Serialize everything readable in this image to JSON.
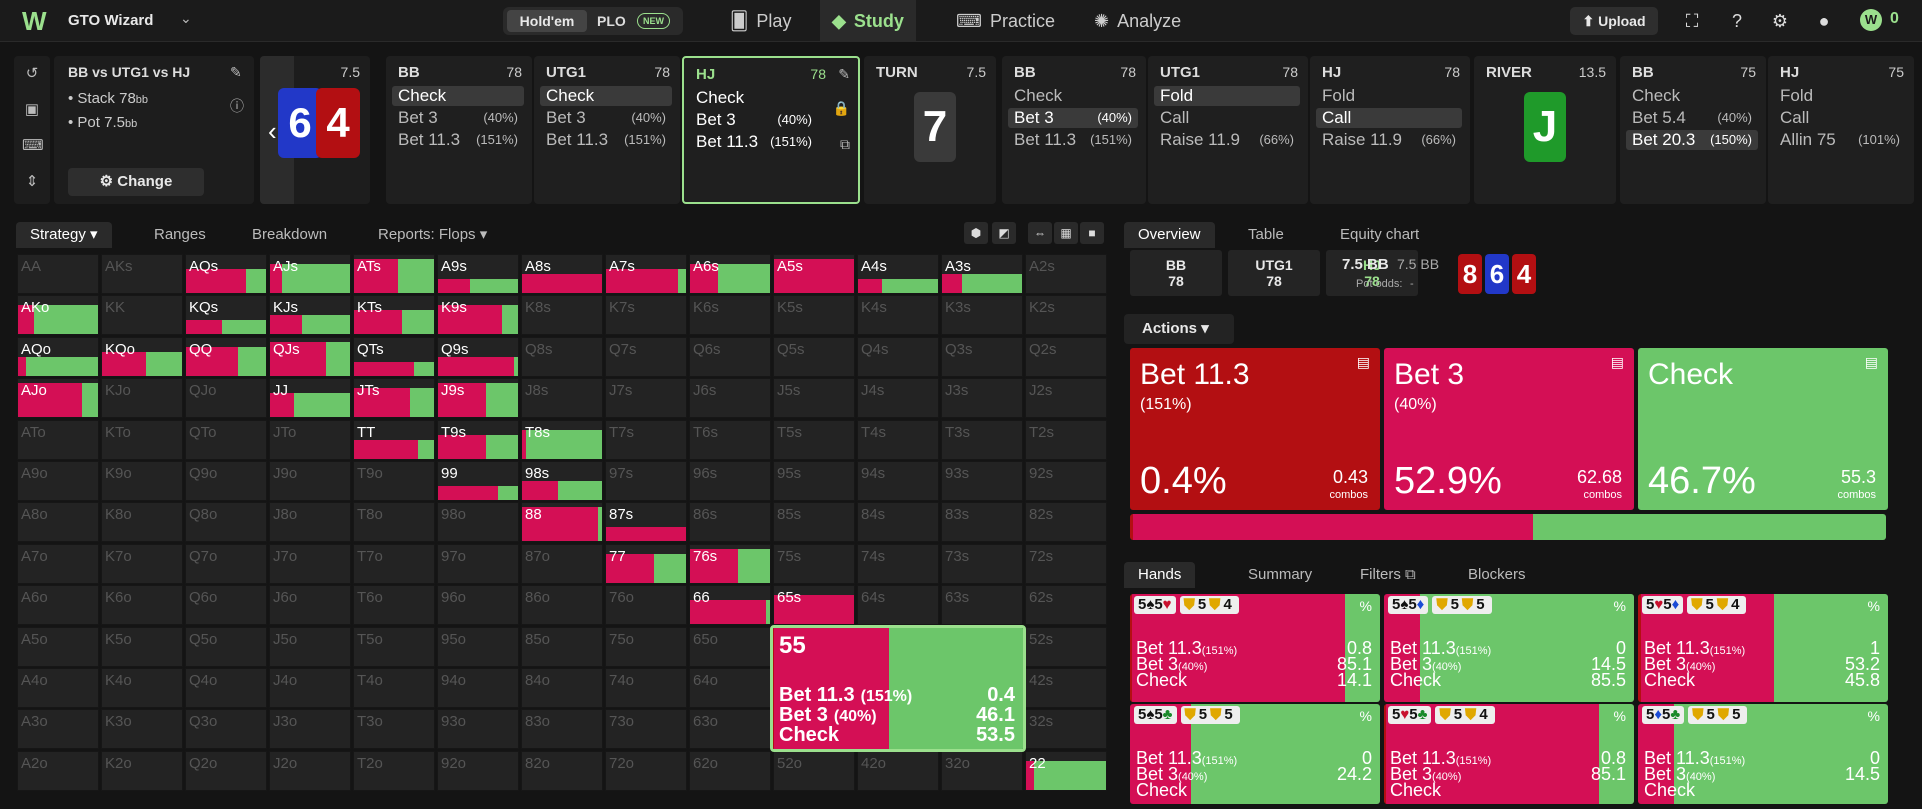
{
  "app": {
    "brand": "GTO Wizard",
    "game_holdem": "Hold'em",
    "game_plo": "PLO",
    "new_badge": "NEW",
    "nav": [
      "Play",
      "Study",
      "Practice",
      "Analyze"
    ],
    "upload": "Upload",
    "coins": "0"
  },
  "info": {
    "title": "BB vs UTG1 vs HJ",
    "stack": "• Stack 78",
    "stack_unit": "bb",
    "pot": "• Pot 7.5",
    "pot_unit": "bb",
    "change": "Change",
    "flop_pot": "7.5"
  },
  "flop_cards": [
    {
      "rank": "6",
      "color": "#2238c8"
    },
    {
      "rank": "4",
      "color": "#b30f12"
    }
  ],
  "players": [
    {
      "name": "BB",
      "stack": "78",
      "actions": [
        {
          "a": "Check",
          "p": "",
          "hl": true
        },
        {
          "a": "Bet 3",
          "p": "(40%)"
        },
        {
          "a": "Bet 11.3",
          "p": "(151%)"
        }
      ]
    },
    {
      "name": "UTG1",
      "stack": "78",
      "actions": [
        {
          "a": "Check",
          "p": "",
          "hl": true
        },
        {
          "a": "Bet 3",
          "p": "(40%)"
        },
        {
          "a": "Bet 11.3",
          "p": "(151%)"
        }
      ]
    },
    {
      "name": "HJ",
      "stack": "78",
      "sel": true,
      "actions": [
        {
          "a": "Check",
          "p": "",
          "strong": true
        },
        {
          "a": "Bet 3",
          "p": "(40%)",
          "strong": true
        },
        {
          "a": "Bet 11.3",
          "p": "(151%)",
          "strong": true
        }
      ]
    },
    {
      "name": "BB",
      "stack": "78",
      "actions": [
        {
          "a": "Check",
          "p": ""
        },
        {
          "a": "Bet 3",
          "p": "(40%)",
          "hl": true
        },
        {
          "a": "Bet 11.3",
          "p": "(151%)"
        }
      ]
    },
    {
      "name": "UTG1",
      "stack": "78",
      "actions": [
        {
          "a": "Fold",
          "p": "",
          "hl": true
        },
        {
          "a": "Call",
          "p": ""
        },
        {
          "a": "Raise 11.9",
          "p": "(66%)"
        }
      ]
    },
    {
      "name": "HJ",
      "stack": "78",
      "actions": [
        {
          "a": "Fold",
          "p": ""
        },
        {
          "a": "Call",
          "p": "",
          "hl": true
        },
        {
          "a": "Raise 11.9",
          "p": "(66%)"
        }
      ]
    },
    {
      "name": "BB",
      "stack": "75",
      "actions": [
        {
          "a": "Check",
          "p": ""
        },
        {
          "a": "Bet 5.4",
          "p": "(40%)"
        },
        {
          "a": "Bet 20.3",
          "p": "(150%)",
          "hl": true
        }
      ]
    },
    {
      "name": "HJ",
      "stack": "75",
      "actions": [
        {
          "a": "Fold",
          "p": ""
        },
        {
          "a": "Call",
          "p": ""
        },
        {
          "a": "Allin 75",
          "p": "(101%)"
        }
      ]
    }
  ],
  "turn": {
    "label": "TURN",
    "pot": "7.5",
    "card": "7",
    "color": "#3a3a3a"
  },
  "river": {
    "label": "RIVER",
    "pot": "13.5",
    "card": "J",
    "color": "#1f9a2a"
  },
  "left_tabs": [
    "Strategy",
    "Ranges",
    "Breakdown",
    "Reports: Flops"
  ],
  "right_tabs": [
    "Overview",
    "Table",
    "Equity chart"
  ],
  "overview": {
    "players": [
      {
        "n": "BB",
        "s": "78"
      },
      {
        "n": "UTG1",
        "s": "78"
      },
      {
        "n": "HJ",
        "s": "78"
      }
    ],
    "pot": "7.5 BB",
    "pot2": "7.5 BB",
    "odds_label": "Pot odds:",
    "odds": "-",
    "board": [
      {
        "r": "8",
        "c": "#b30f12"
      },
      {
        "r": "6",
        "c": "#2238c8"
      },
      {
        "r": "4",
        "c": "#b30f12"
      }
    ]
  },
  "actions_label": "Actions",
  "big_actions": [
    {
      "name": "Bet 11.3",
      "sub": "(151%)",
      "pct": "0.4%",
      "combos": "0.43",
      "color": "#b30f12"
    },
    {
      "name": "Bet 3",
      "sub": "(40%)",
      "pct": "52.9%",
      "combos": "62.68",
      "color": "#d40f55"
    },
    {
      "name": "Check",
      "sub": "",
      "pct": "46.7%",
      "combos": "55.3",
      "color": "#6cc66a"
    }
  ],
  "combos_label": "combos",
  "freq_bar": [
    0.4,
    52.9,
    46.7
  ],
  "hand_tabs": [
    "Hands",
    "Summary",
    "Filters",
    "Blockers"
  ],
  "hover": {
    "hand": "55",
    "rows": [
      {
        "a": "Bet 11.3",
        "p": "(151%)",
        "v": "0.4"
      },
      {
        "a": "Bet 3",
        "p": "(40%)",
        "v": "46.1"
      },
      {
        "a": "Check",
        "p": "",
        "v": "53.5"
      }
    ],
    "mix": [
      0.4,
      46.1,
      53.5
    ]
  },
  "hand_cards": [
    {
      "h": [
        {
          "r": "5",
          "s": "♠"
        },
        {
          "r": "5",
          "s": "♥"
        }
      ],
      "chips": [
        "5",
        "4"
      ],
      "vals": [
        "0.8",
        "85.1",
        "14.1"
      ],
      "mix": [
        0.8,
        85.1,
        14.1
      ]
    },
    {
      "h": [
        {
          "r": "5",
          "s": "♠"
        },
        {
          "r": "5",
          "s": "♦"
        }
      ],
      "chips": [
        "5",
        "5"
      ],
      "vals": [
        "0",
        "14.5",
        "85.5"
      ],
      "mix": [
        0,
        14.5,
        85.5
      ]
    },
    {
      "h": [
        {
          "r": "5",
          "s": "♥"
        },
        {
          "r": "5",
          "s": "♦"
        }
      ],
      "chips": [
        "5",
        "4"
      ],
      "vals": [
        "1",
        "53.2",
        "45.8"
      ],
      "mix": [
        1,
        53.2,
        45.8
      ]
    },
    {
      "h": [
        {
          "r": "5",
          "s": "♠"
        },
        {
          "r": "5",
          "s": "♣"
        }
      ],
      "chips": [
        "5",
        "5"
      ],
      "vals": [
        "0",
        "24.2",
        ""
      ],
      "mix": [
        0,
        24.2,
        75.8
      ]
    },
    {
      "h": [
        {
          "r": "5",
          "s": "♥"
        },
        {
          "r": "5",
          "s": "♣"
        }
      ],
      "chips": [
        "5",
        "4"
      ],
      "vals": [
        "0.8",
        "85.1",
        ""
      ],
      "mix": [
        0.8,
        85.1,
        14.1
      ]
    },
    {
      "h": [
        {
          "r": "5",
          "s": "♦"
        },
        {
          "r": "5",
          "s": "♣"
        }
      ],
      "chips": [
        "5",
        "5"
      ],
      "vals": [
        "0",
        "14.5",
        ""
      ],
      "mix": [
        0,
        14.5,
        85.5
      ]
    }
  ],
  "hc_actions": [
    {
      "a": "Bet 11.3",
      "p": "(151%)"
    },
    {
      "a": "Bet 3",
      "p": "(40%)"
    },
    {
      "a": "Check",
      "p": ""
    }
  ],
  "ranks": [
    "A",
    "K",
    "Q",
    "J",
    "T",
    "9",
    "8",
    "7",
    "6",
    "5",
    "4",
    "3",
    "2"
  ],
  "grid_active": {
    "AQs": [
      0,
      75,
      25
    ],
    "AJs": [
      0,
      15,
      85
    ],
    "ATs": [
      0,
      55,
      45
    ],
    "A9s": [
      0,
      40,
      60
    ],
    "A8s": [
      0,
      100,
      0
    ],
    "A7s": [
      0,
      90,
      10
    ],
    "A6s": [
      0,
      35,
      65
    ],
    "A5s": [
      0,
      100,
      0
    ],
    "A4s": [
      0,
      30,
      70
    ],
    "A3s": [
      0,
      25,
      75
    ],
    "AKo": [
      0,
      20,
      80
    ],
    "KQs": [
      0,
      45,
      55
    ],
    "KJs": [
      0,
      40,
      60
    ],
    "KTs": [
      0,
      60,
      40
    ],
    "K9s": [
      0,
      80,
      20
    ],
    "AQo": [
      0,
      10,
      90
    ],
    "KQo": [
      0,
      55,
      45
    ],
    "QQ": [
      0,
      65,
      35
    ],
    "QJs": [
      0,
      70,
      30
    ],
    "QTs": [
      0,
      75,
      25
    ],
    "Q9s": [
      0,
      95,
      5
    ],
    "AJo": [
      0,
      80,
      20
    ],
    "JJ": [
      0,
      30,
      70
    ],
    "JTs": [
      0,
      70,
      30
    ],
    "J9s": [
      0,
      60,
      40
    ],
    "TT": [
      0,
      80,
      20
    ],
    "T9s": [
      0,
      60,
      40
    ],
    "T8s": [
      0,
      5,
      95
    ],
    "99": [
      0,
      75,
      25
    ],
    "98s": [
      0,
      45,
      55
    ],
    "88": [
      0,
      95,
      5
    ],
    "87s": [
      0,
      100,
      0
    ],
    "77": [
      0,
      60,
      40
    ],
    "76s": [
      0,
      60,
      40
    ],
    "66": [
      0,
      95,
      5
    ],
    "65s": [
      0,
      100,
      0
    ],
    "55": [
      0.4,
      46.1,
      53.5
    ],
    "22": [
      0,
      10,
      90
    ]
  },
  "colors": {
    "bet_big": "#b30f12",
    "bet_small": "#d40f55",
    "check": "#6cc66a",
    "accent": "#9be08d"
  }
}
